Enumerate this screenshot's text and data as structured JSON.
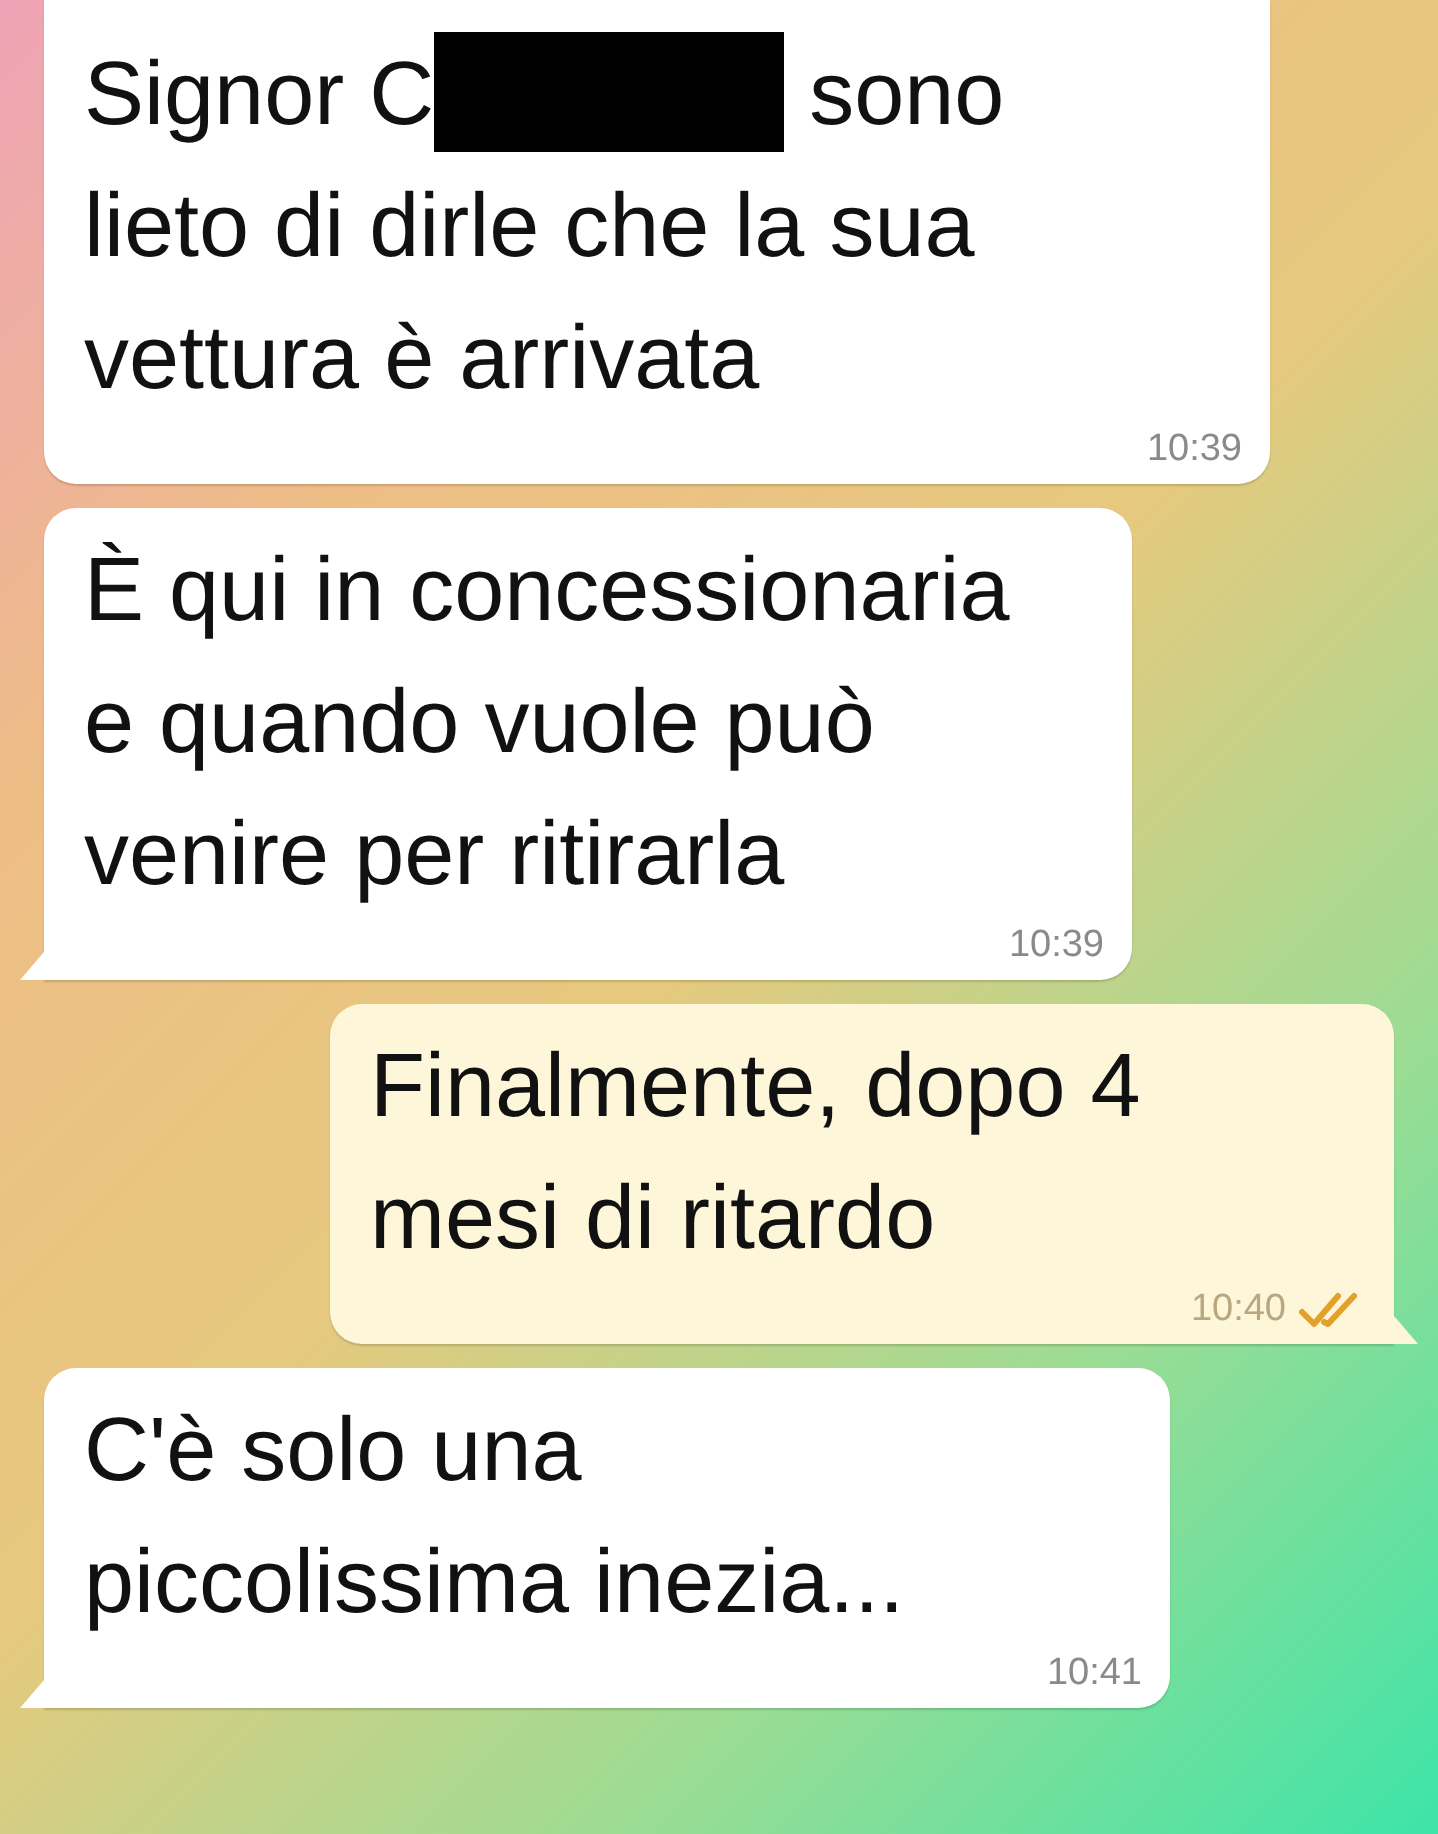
{
  "messages": [
    {
      "outgoing": false,
      "tail": false,
      "segments": [
        {
          "kind": "text",
          "text": "Signor C"
        },
        {
          "kind": "redaction"
        },
        {
          "kind": "text",
          "text": " sono lieto di dirle che la sua vettura è arrivata"
        }
      ],
      "time": "10:39"
    },
    {
      "outgoing": false,
      "tail": true,
      "segments": [
        {
          "kind": "text",
          "text": "È qui in concessionaria e quando vuole può venire per ritirarla"
        }
      ],
      "time": "10:39"
    },
    {
      "outgoing": true,
      "tail": true,
      "read": true,
      "segments": [
        {
          "kind": "text",
          "text": "Finalmente, dopo 4 mesi di ritardo"
        }
      ],
      "time": "10:40"
    },
    {
      "outgoing": false,
      "tail": true,
      "segments": [
        {
          "kind": "text",
          "text": "C'è solo una piccolissima inezia..."
        }
      ],
      "time": "10:41"
    }
  ]
}
